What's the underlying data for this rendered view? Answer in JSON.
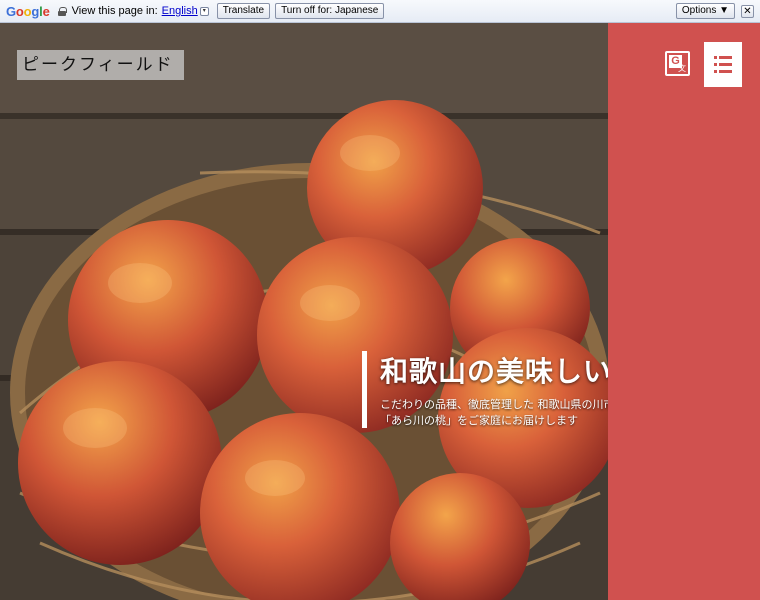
{
  "translate_bar": {
    "logo": "Google",
    "prompt": "View this page in:",
    "language": "English",
    "translate_label": "Translate",
    "turn_off_label": "Turn off for: Japanese",
    "options_label": "Options ▼",
    "close_label": "✕"
  },
  "header": {
    "site_logo": "ピークフィールド"
  },
  "hero": {
    "headline": "和歌山の美味しい桃なら",
    "sub_line_1": "こだわりの品種、徹底管理した 和歌山県の川市名産の",
    "sub_line_2": "「あら川の桃」をご家庭にお届けします"
  },
  "side_panel": {
    "translate_icon_g": "G",
    "translate_icon_x": "文"
  },
  "colors": {
    "accent_red": "#d0514f",
    "wood_dark": "#3d352d",
    "peach_red": "#c9473a",
    "peach_orange": "#e98a3a"
  }
}
